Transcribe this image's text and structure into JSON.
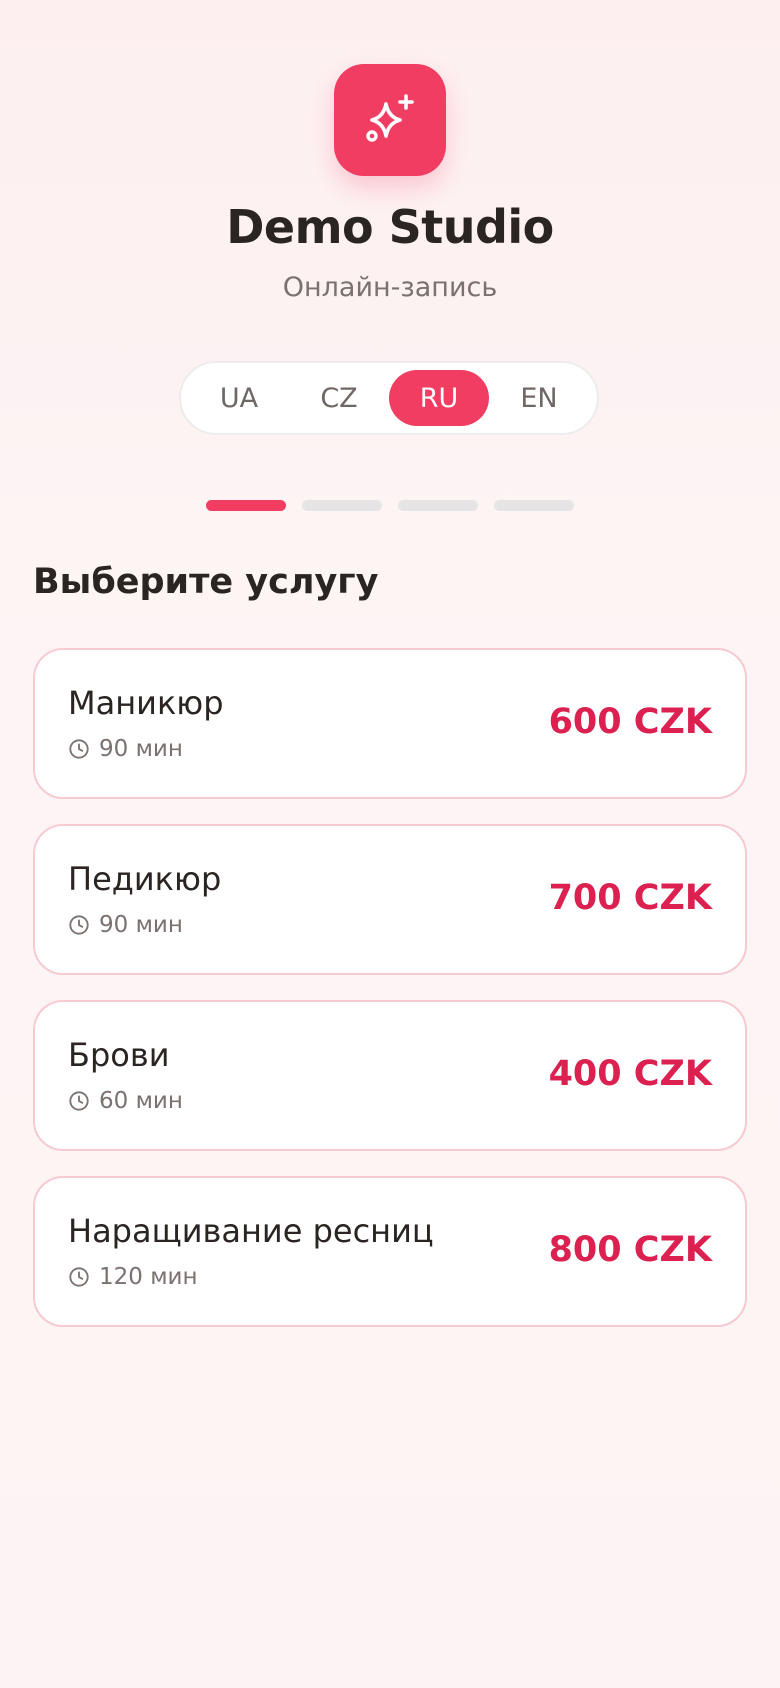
{
  "header": {
    "logo_icon": "sparkles-icon",
    "title": "Demo Studio",
    "subtitle": "Онлайн-запись"
  },
  "languages": {
    "items": [
      "UA",
      "CZ",
      "RU",
      "EN"
    ],
    "selected": "RU"
  },
  "steps": {
    "total": 4,
    "current": 1
  },
  "section_title": "Выберите услугу",
  "services": [
    {
      "name": "Маникюр",
      "duration": "90 мин",
      "price": "600 CZK"
    },
    {
      "name": "Педикюр",
      "duration": "90 мин",
      "price": "700 CZK"
    },
    {
      "name": "Брови",
      "duration": "60 мин",
      "price": "400 CZK"
    },
    {
      "name": "Наращивание ресниц",
      "duration": "120 мин",
      "price": "800 CZK"
    }
  ],
  "colors": {
    "accent": "#f23d62",
    "price": "#dc2050",
    "card_border": "#f7c9d1"
  }
}
